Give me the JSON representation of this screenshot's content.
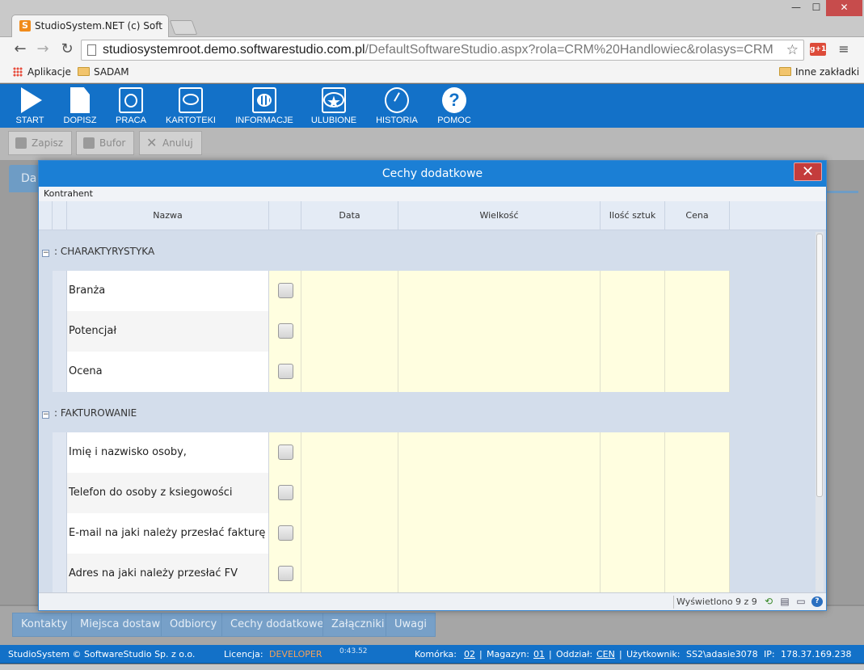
{
  "browser": {
    "tab_title": "StudioSystem.NET (c) Soft",
    "favicon_letter": "S",
    "url_host": "studiosystemroot.demo.softwarestudio.com.pl",
    "url_path": "/DefaultSoftwareStudio.aspx?rola=CRM%20Handlowiec&rolasys=CRM",
    "gplus_label": "g+1",
    "bookmarks": {
      "apps": "Aplikacje",
      "folder": "SADAM",
      "other": "Inne zakładki"
    }
  },
  "ribbon": {
    "items": [
      {
        "label": "START",
        "icon": "play-icon"
      },
      {
        "label": "DOPISZ",
        "icon": "document-icon"
      },
      {
        "label": "PRACA",
        "icon": "work-icon"
      },
      {
        "label": "KARTOTEKI",
        "icon": "monitor-icon"
      },
      {
        "label": "INFORMACJE",
        "icon": "chart-icon"
      },
      {
        "label": "ULUBIONE",
        "icon": "star-icon"
      },
      {
        "label": "HISTORIA",
        "icon": "history-icon"
      },
      {
        "label": "POMOC",
        "icon": "help-icon"
      }
    ]
  },
  "toolbar": {
    "save_label": "Zapisz",
    "buffer_label": "Bufor",
    "cancel_label": "Anuluj"
  },
  "background": {
    "tab_label": "Da"
  },
  "dialog": {
    "title": "Cechy dodatkowe",
    "close_glyph": "✕",
    "subtitle": "Kontrahent",
    "columns": {
      "name": "Nazwa",
      "flag": "",
      "date": "Data",
      "size": "Wielkość",
      "qty": "Ilość sztuk",
      "price": "Cena"
    },
    "groups": [
      {
        "label": ": CHARAKTYRYSTYKA",
        "rows": [
          "Branża",
          "Potencjał",
          "Ocena"
        ]
      },
      {
        "label": ": FAKTUROWANIE",
        "rows": [
          "Imię i nazwisko osoby,",
          "Telefon do osoby z ksiegowości",
          "E-mail na jaki należy przesłać fakturę",
          "Adres na jaki należy przesłać FV"
        ]
      }
    ],
    "footer": {
      "info": "Wyświetlono 9 z 9"
    }
  },
  "bottom_tabs": [
    "Kontakty",
    "Miejsca dostaw",
    "Odbiorcy",
    "Cechy dodatkowe",
    "Załączniki",
    "Uwagi"
  ],
  "status": {
    "company": "StudioSystem © SoftwareStudio Sp. z o.o.",
    "license_label": "Licencja:",
    "license_value": "DEVELOPER",
    "timer": "0:43.52",
    "cell_label": "Komórka:",
    "cell_value": "02",
    "warehouse_label": "Magazyn:",
    "warehouse_value": "01",
    "branch_label": "Oddział:",
    "branch_value": "CEN",
    "user_label": "Użytkownik:",
    "user_value": "SS2\\adasie3078",
    "ip_label": "IP:",
    "ip_value": "178.37.169.238",
    "sep": "|"
  },
  "colors": {
    "accent": "#1371c8",
    "dialog_title": "#1b7fd5",
    "close_red": "#c43c3c",
    "editable_cell": "#fffee0",
    "license_orange": "#f4a25a"
  }
}
